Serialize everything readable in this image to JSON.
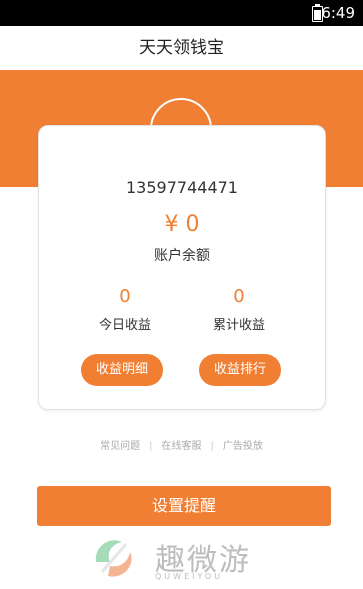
{
  "status_bar": {
    "time": "6:49",
    "battery_icon": "battery-icon"
  },
  "header": {
    "title": "天天领钱宝"
  },
  "account": {
    "phone": "13597744471",
    "balance": "¥ 0",
    "balance_label": "账户余额"
  },
  "stats": {
    "today": {
      "value": "0",
      "label": "今日收益"
    },
    "total": {
      "value": "0",
      "label": "累计收益"
    }
  },
  "buttons": {
    "earnings_detail": "收益明细",
    "earnings_ranking": "收益排行",
    "set_reminder": "设置提醒"
  },
  "footer_links": [
    "常见问题",
    "在线客服",
    "广告投放"
  ],
  "watermark": {
    "name": "趣微游",
    "sub": "QUWEIYOU"
  },
  "colors": {
    "accent": "#f07f33"
  }
}
